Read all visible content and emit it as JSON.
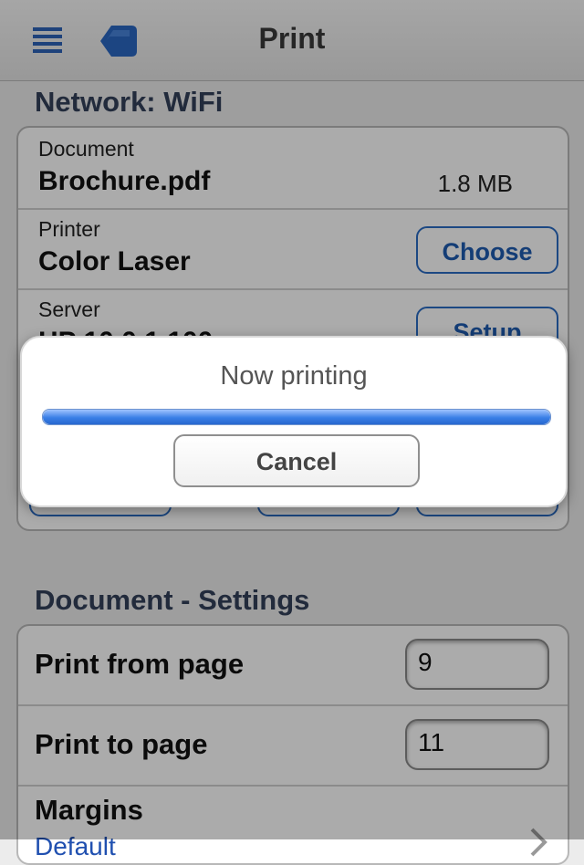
{
  "nav": {
    "title": "Print"
  },
  "network": {
    "header": "Network: WiFi",
    "document_label": "Document",
    "document_name": "Brochure.pdf",
    "document_size": "1.8 MB",
    "printer_label": "Printer",
    "printer_name": "Color Laser",
    "choose_label": "Choose",
    "server_label": "Server",
    "server_value": "HP 10.0.1.100",
    "setup_label": "Setup"
  },
  "settings": {
    "header": "Document - Settings",
    "from_label": "Print from page",
    "from_value": "9",
    "to_label": "Print to page",
    "to_value": "11",
    "margins_label": "Margins",
    "margins_value": "Default"
  },
  "dialog": {
    "title": "Now printing",
    "progress": 1.0,
    "cancel_label": "Cancel"
  },
  "colors": {
    "accent": "#2b6cc4",
    "header": "#34405a"
  },
  "icons": {
    "menu": "menu-icon",
    "back": "back-icon",
    "chevron": "chevron-right-icon"
  }
}
